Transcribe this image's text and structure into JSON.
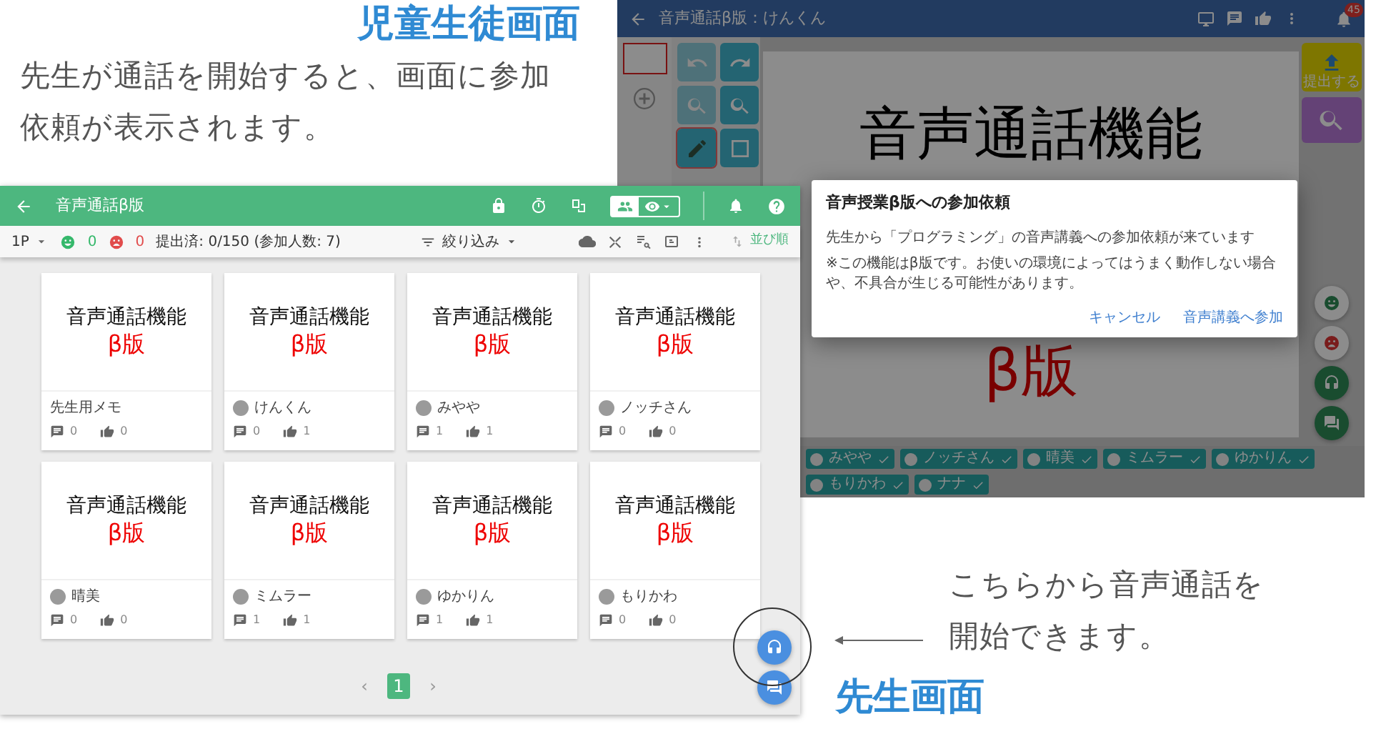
{
  "annotations": {
    "student_title": "児童生徒画面",
    "student_note": [
      "先生が通話を開始すると、画面に参加",
      "依頼が表示されます。"
    ],
    "teacher_note": [
      "こちらから音声通話を",
      "開始できます。"
    ],
    "teacher_title": "先生画面"
  },
  "student_screen": {
    "title": "音声通話β版：けんくん",
    "notification_badge": "45",
    "submit_label": "提出する",
    "canvas": {
      "heading": "音声通話機能",
      "subheading": "β版"
    },
    "dialog": {
      "title": "音声授業β版への参加依頼",
      "message": "先生から「プログラミング」の音声講義への参加依頼が来ています",
      "note": "※この機能はβ版です。お使いの環境によってはうまく動作しない場合や、不具合が生じる可能性があります。",
      "buttons": [
        "キャンセル",
        "音声講義へ参加"
      ]
    },
    "participants": [
      {
        "name": "みやや"
      },
      {
        "name": "ノッチさん"
      },
      {
        "name": "晴美"
      },
      {
        "name": "ミムラー"
      },
      {
        "name": "ゆかりん"
      },
      {
        "name": "もりかわ"
      },
      {
        "name": "ナナ"
      }
    ]
  },
  "teacher_screen": {
    "title": "音声通話β版",
    "page": "1P",
    "happy_count": "0",
    "sad_count": "0",
    "submission": "提出済: 0/150 (参加人数: 7)",
    "filter": "絞り込み",
    "sort": "並び順",
    "cards": [
      {
        "heading": "音声通話機能",
        "subheading": "β版",
        "author": "先生用メモ",
        "avatar": false,
        "comments": "0",
        "likes": "0"
      },
      {
        "heading": "音声通話機能",
        "subheading": "β版",
        "author": "けんくん",
        "avatar": true,
        "comments": "0",
        "likes": "1"
      },
      {
        "heading": "音声通話機能",
        "subheading": "β版",
        "author": "みやや",
        "avatar": true,
        "comments": "1",
        "likes": "1"
      },
      {
        "heading": "音声通話機能",
        "subheading": "β版",
        "author": "ノッチさん",
        "avatar": true,
        "comments": "0",
        "likes": "0"
      },
      {
        "heading": "音声通話機能",
        "subheading": "β版",
        "author": "晴美",
        "avatar": true,
        "comments": "0",
        "likes": "0"
      },
      {
        "heading": "音声通話機能",
        "subheading": "β版",
        "author": "ミムラー",
        "avatar": true,
        "comments": "1",
        "likes": "1"
      },
      {
        "heading": "音声通話機能",
        "subheading": "β版",
        "author": "ゆかりん",
        "avatar": true,
        "comments": "1",
        "likes": "1"
      },
      {
        "heading": "音声通話機能",
        "subheading": "β版",
        "author": "もりかわ",
        "avatar": true,
        "comments": "0",
        "likes": "0"
      }
    ],
    "pagination": [
      {
        "label": "‹",
        "selected": false
      },
      {
        "label": "1",
        "selected": true
      },
      {
        "label": "›",
        "selected": false
      }
    ]
  }
}
